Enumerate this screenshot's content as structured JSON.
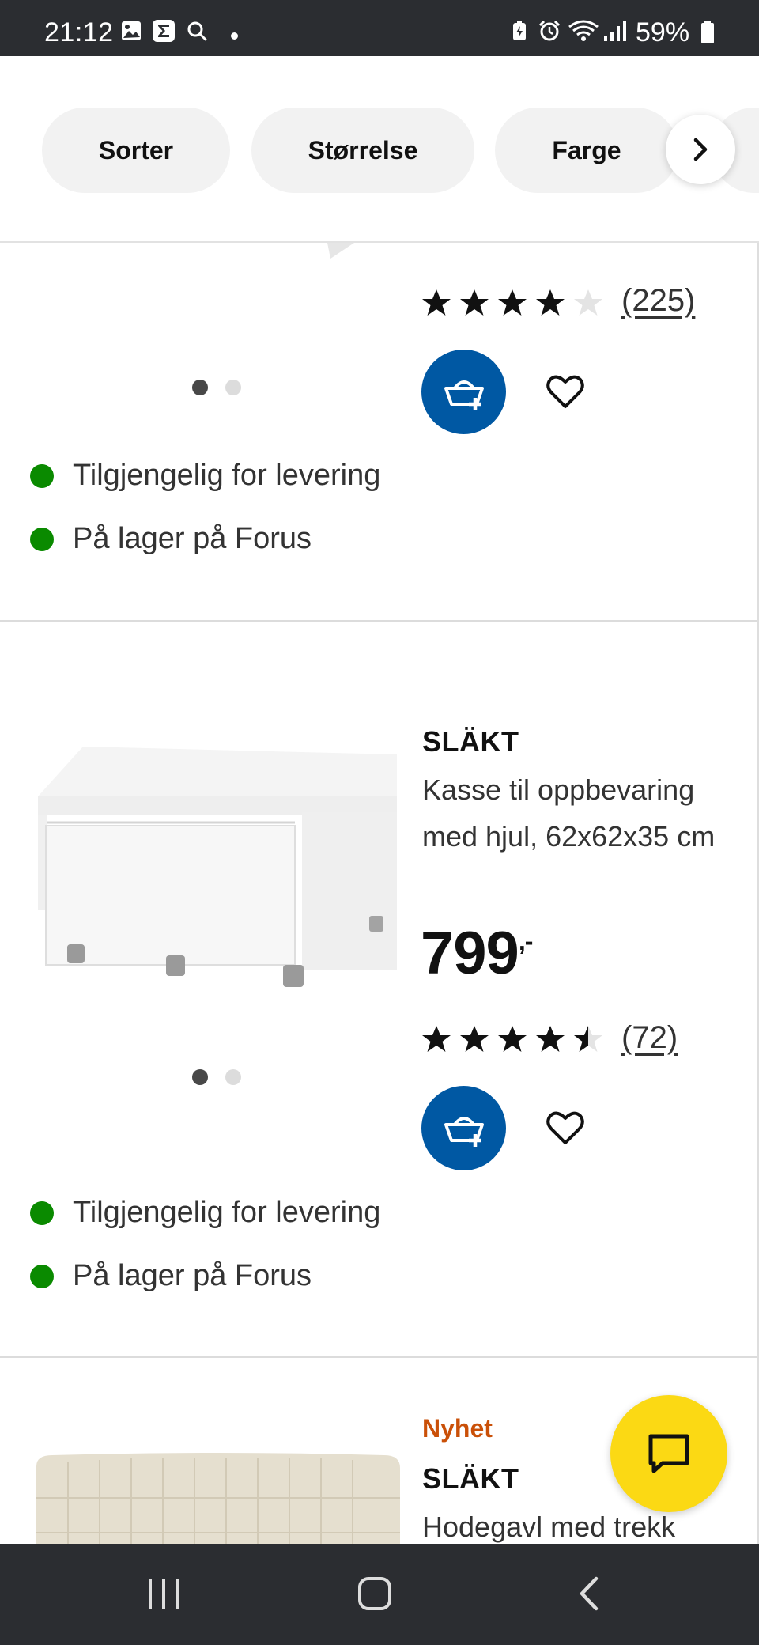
{
  "status_bar": {
    "time": "21:12",
    "battery_percent": "59%",
    "left_icons": [
      "image-icon",
      "sigma-app-icon",
      "search-icon",
      "dot-icon"
    ],
    "right_icons": [
      "battery-saver-icon",
      "alarm-icon",
      "wifi-icon",
      "signal-icon",
      "battery-icon"
    ]
  },
  "filters": {
    "chips": [
      "Sorter",
      "Størrelse",
      "Farge"
    ],
    "next_icon": "chevron-right-icon"
  },
  "products": [
    {
      "rating": 4,
      "review_count": "(225)",
      "image_dots": 2,
      "active_dot": 0,
      "availability": [
        "Tilgjengelig for levering",
        "På lager på Forus"
      ]
    },
    {
      "brand": "SLÄKT",
      "description": "Kasse til oppbevaring med hjul, 62x62x35 cm",
      "price": "799",
      "price_suffix": ",-",
      "rating": 4.5,
      "review_count": "(72)",
      "image_dots": 2,
      "active_dot": 0,
      "availability": [
        "Tilgjengelig for levering",
        "På lager på Forus"
      ]
    },
    {
      "badge": "Nyhet",
      "brand": "SLÄKT",
      "description": "Hodegavl med trekk"
    }
  ],
  "actions": {
    "add_to_cart_icon": "add-to-basket-icon",
    "favourite_icon": "heart-icon",
    "chat_icon": "chat-icon"
  },
  "colors": {
    "cart_blue": "#0058a3",
    "stock_green": "#0a8a00",
    "new_orange": "#ca5008",
    "chat_yellow": "#fbd914"
  },
  "nav_bar": {
    "icons": [
      "recent-apps-icon",
      "home-icon",
      "back-icon"
    ]
  }
}
